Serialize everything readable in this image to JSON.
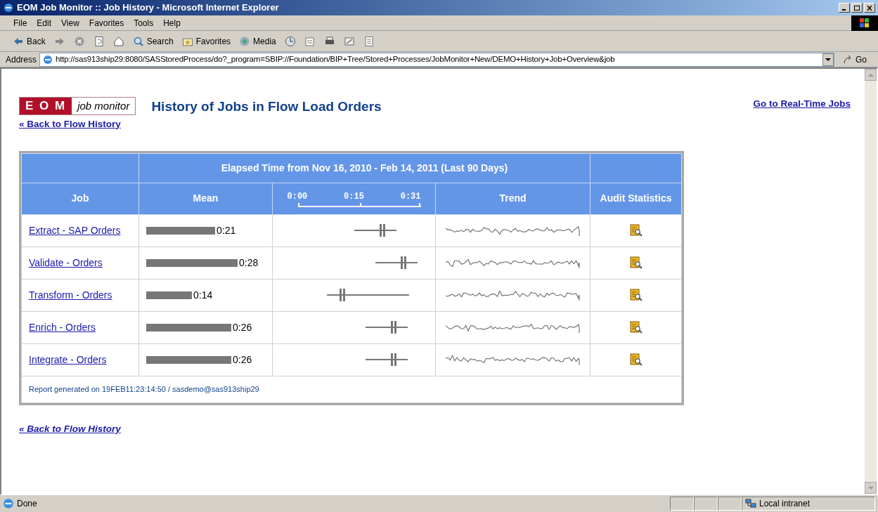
{
  "window": {
    "title": "EOM Job Monitor :: Job History - Microsoft Internet Explorer"
  },
  "menu": [
    "File",
    "Edit",
    "View",
    "Favorites",
    "Tools",
    "Help"
  ],
  "toolbar": [
    {
      "kind": "back",
      "label": "Back"
    },
    {
      "kind": "forward"
    },
    {
      "kind": "stop"
    },
    {
      "kind": "refresh"
    },
    {
      "kind": "home"
    },
    {
      "kind": "search",
      "label": "Search"
    },
    {
      "kind": "favorites",
      "label": "Favorites"
    },
    {
      "kind": "media",
      "label": "Media"
    },
    {
      "kind": "history"
    },
    {
      "kind": "mail"
    },
    {
      "kind": "print"
    },
    {
      "kind": "edit"
    },
    {
      "kind": "discuss"
    }
  ],
  "address": {
    "label": "Address",
    "value": "http://sas913ship29:8080/SASStoredProcess/do?_program=SBIP://Foundation/BIP+Tree/Stored+Processes/JobMonitor+New/DEMO+History+Job+Overview&job",
    "go": "Go"
  },
  "page": {
    "logo_left": "E O M",
    "logo_right": "job monitor",
    "title": "History of Jobs in Flow Load Orders",
    "back_link": "« Back to Flow History",
    "realtime_link": "Go to Real-Time Jobs",
    "table": {
      "group_header": "Elapsed Time from Nov 16, 2010 - Feb 14, 2011 (Last 90 Days)",
      "columns": [
        "Job",
        "Mean",
        "Trend",
        "Audit Statistics"
      ],
      "axis_ticks": [
        "0:00",
        "0:15",
        "0:31"
      ],
      "rows": [
        {
          "job": "Extract - SAP Orders",
          "mean": "0:21"
        },
        {
          "job": "Validate - Orders",
          "mean": "0:28"
        },
        {
          "job": "Transform - Orders",
          "mean": "0:14"
        },
        {
          "job": "Enrich - Orders",
          "mean": "0:26"
        },
        {
          "job": "Integrate - Orders",
          "mean": "0:26"
        }
      ],
      "footer": "Report generated on 19FEB11:23:14:50 / sasdemo@sas913ship29"
    },
    "bottom_link": "« Back to Flow History"
  },
  "status_bar": {
    "text": "Done",
    "zone": "Local intranet"
  }
}
